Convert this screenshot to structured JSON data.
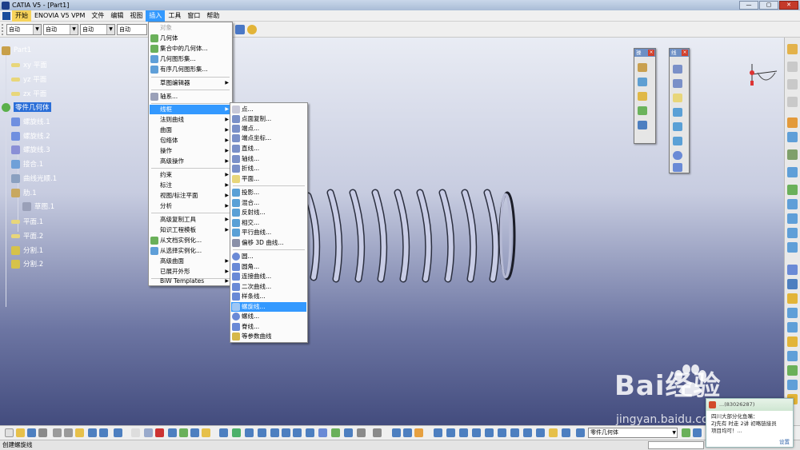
{
  "window": {
    "title": "CATIA V5 - [Part1]",
    "buttons": [
      "—",
      "▢",
      "✕"
    ]
  },
  "menubar": {
    "items": [
      "开始",
      "ENOVIA V5 VPM",
      "文件",
      "编辑",
      "视图",
      "插入",
      "工具",
      "窗口",
      "帮助"
    ],
    "active_index": 5,
    "mdi_buttons": [
      "_",
      "▫",
      "×"
    ]
  },
  "toolbar": {
    "combos": [
      "自动",
      "自动",
      "自动",
      "自动"
    ]
  },
  "tree": {
    "root": "Part1",
    "items": [
      "xy 平面",
      "yz 平面",
      "zx 平面",
      "零件几何体",
      "螺旋线.1",
      "螺旋线.2",
      "螺旋线.3",
      "接合.1",
      "曲线光顺.1",
      "肋.1",
      "草图.1",
      "平面.1",
      "平面.2",
      "分割.1",
      "分割.2"
    ]
  },
  "insert_menu": {
    "items": [
      "对象",
      "几何体",
      "集合中的几何体...",
      "几何图形集...",
      "有序几何图形集...",
      "草图编辑器",
      "轴系...",
      "线框",
      "法则曲线",
      "曲面",
      "包络体",
      "操作",
      "高级操作",
      "约束",
      "标注",
      "视图/标注平面",
      "分析",
      "高级复制工具",
      "知识工程模板",
      "从文档实例化...",
      "从选择实例化...",
      "高级曲面",
      "已展开外形",
      "BiW Templates"
    ],
    "highlight": "线框"
  },
  "wireframe_menu": {
    "items": [
      "点...",
      "点面复制...",
      "端点...",
      "端点坐标...",
      "直线...",
      "轴线...",
      "折线...",
      "平面...",
      "投影...",
      "混合...",
      "反射线...",
      "相交...",
      "平行曲线...",
      "偏移 3D 曲线...",
      "圆...",
      "圆角...",
      "连接曲线...",
      "二次曲线...",
      "样条线...",
      "螺旋线...",
      "螺线...",
      "脊线...",
      "等参数曲线"
    ],
    "highlight": "螺旋线..."
  },
  "float_toolbars": {
    "ops": "操",
    "wire": "线"
  },
  "bottom": {
    "combo": "零件几何体"
  },
  "status": {
    "text": "创建螺旋线"
  },
  "watermark": {
    "brand": "Bai经验",
    "url": "jingyan.baidu.com"
  },
  "chat": {
    "title": "...(83026287)",
    "line1": "四川大部分化鱼嘴：",
    "line2": "ZJ先有 时走 2讲 初略链接员",
    "line3": "项目均可！...",
    "footer": "设置"
  },
  "colors": {
    "accent": "#3399ff",
    "tree_sel": "#2a6ed8",
    "viewport_top": "#e9ecf4",
    "viewport_bottom": "#434c7e"
  }
}
